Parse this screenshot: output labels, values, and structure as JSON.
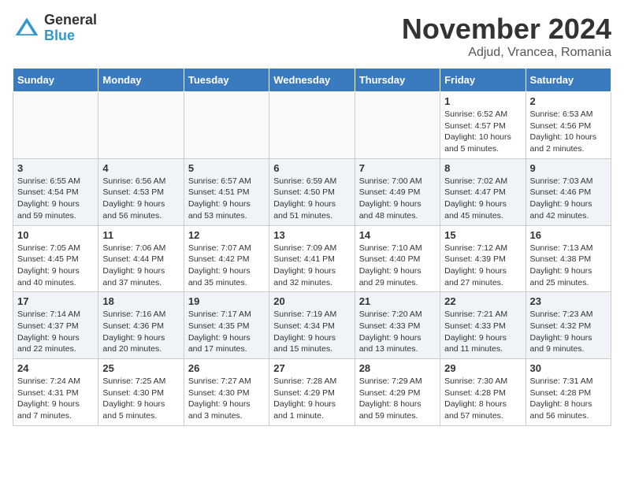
{
  "logo": {
    "general": "General",
    "blue": "Blue"
  },
  "header": {
    "month": "November 2024",
    "location": "Adjud, Vrancea, Romania"
  },
  "days_of_week": [
    "Sunday",
    "Monday",
    "Tuesday",
    "Wednesday",
    "Thursday",
    "Friday",
    "Saturday"
  ],
  "weeks": [
    [
      {
        "day": "",
        "info": ""
      },
      {
        "day": "",
        "info": ""
      },
      {
        "day": "",
        "info": ""
      },
      {
        "day": "",
        "info": ""
      },
      {
        "day": "",
        "info": ""
      },
      {
        "day": "1",
        "info": "Sunrise: 6:52 AM\nSunset: 4:57 PM\nDaylight: 10 hours and 5 minutes."
      },
      {
        "day": "2",
        "info": "Sunrise: 6:53 AM\nSunset: 4:56 PM\nDaylight: 10 hours and 2 minutes."
      }
    ],
    [
      {
        "day": "3",
        "info": "Sunrise: 6:55 AM\nSunset: 4:54 PM\nDaylight: 9 hours and 59 minutes."
      },
      {
        "day": "4",
        "info": "Sunrise: 6:56 AM\nSunset: 4:53 PM\nDaylight: 9 hours and 56 minutes."
      },
      {
        "day": "5",
        "info": "Sunrise: 6:57 AM\nSunset: 4:51 PM\nDaylight: 9 hours and 53 minutes."
      },
      {
        "day": "6",
        "info": "Sunrise: 6:59 AM\nSunset: 4:50 PM\nDaylight: 9 hours and 51 minutes."
      },
      {
        "day": "7",
        "info": "Sunrise: 7:00 AM\nSunset: 4:49 PM\nDaylight: 9 hours and 48 minutes."
      },
      {
        "day": "8",
        "info": "Sunrise: 7:02 AM\nSunset: 4:47 PM\nDaylight: 9 hours and 45 minutes."
      },
      {
        "day": "9",
        "info": "Sunrise: 7:03 AM\nSunset: 4:46 PM\nDaylight: 9 hours and 42 minutes."
      }
    ],
    [
      {
        "day": "10",
        "info": "Sunrise: 7:05 AM\nSunset: 4:45 PM\nDaylight: 9 hours and 40 minutes."
      },
      {
        "day": "11",
        "info": "Sunrise: 7:06 AM\nSunset: 4:44 PM\nDaylight: 9 hours and 37 minutes."
      },
      {
        "day": "12",
        "info": "Sunrise: 7:07 AM\nSunset: 4:42 PM\nDaylight: 9 hours and 35 minutes."
      },
      {
        "day": "13",
        "info": "Sunrise: 7:09 AM\nSunset: 4:41 PM\nDaylight: 9 hours and 32 minutes."
      },
      {
        "day": "14",
        "info": "Sunrise: 7:10 AM\nSunset: 4:40 PM\nDaylight: 9 hours and 29 minutes."
      },
      {
        "day": "15",
        "info": "Sunrise: 7:12 AM\nSunset: 4:39 PM\nDaylight: 9 hours and 27 minutes."
      },
      {
        "day": "16",
        "info": "Sunrise: 7:13 AM\nSunset: 4:38 PM\nDaylight: 9 hours and 25 minutes."
      }
    ],
    [
      {
        "day": "17",
        "info": "Sunrise: 7:14 AM\nSunset: 4:37 PM\nDaylight: 9 hours and 22 minutes."
      },
      {
        "day": "18",
        "info": "Sunrise: 7:16 AM\nSunset: 4:36 PM\nDaylight: 9 hours and 20 minutes."
      },
      {
        "day": "19",
        "info": "Sunrise: 7:17 AM\nSunset: 4:35 PM\nDaylight: 9 hours and 17 minutes."
      },
      {
        "day": "20",
        "info": "Sunrise: 7:19 AM\nSunset: 4:34 PM\nDaylight: 9 hours and 15 minutes."
      },
      {
        "day": "21",
        "info": "Sunrise: 7:20 AM\nSunset: 4:33 PM\nDaylight: 9 hours and 13 minutes."
      },
      {
        "day": "22",
        "info": "Sunrise: 7:21 AM\nSunset: 4:33 PM\nDaylight: 9 hours and 11 minutes."
      },
      {
        "day": "23",
        "info": "Sunrise: 7:23 AM\nSunset: 4:32 PM\nDaylight: 9 hours and 9 minutes."
      }
    ],
    [
      {
        "day": "24",
        "info": "Sunrise: 7:24 AM\nSunset: 4:31 PM\nDaylight: 9 hours and 7 minutes."
      },
      {
        "day": "25",
        "info": "Sunrise: 7:25 AM\nSunset: 4:30 PM\nDaylight: 9 hours and 5 minutes."
      },
      {
        "day": "26",
        "info": "Sunrise: 7:27 AM\nSunset: 4:30 PM\nDaylight: 9 hours and 3 minutes."
      },
      {
        "day": "27",
        "info": "Sunrise: 7:28 AM\nSunset: 4:29 PM\nDaylight: 9 hours and 1 minute."
      },
      {
        "day": "28",
        "info": "Sunrise: 7:29 AM\nSunset: 4:29 PM\nDaylight: 8 hours and 59 minutes."
      },
      {
        "day": "29",
        "info": "Sunrise: 7:30 AM\nSunset: 4:28 PM\nDaylight: 8 hours and 57 minutes."
      },
      {
        "day": "30",
        "info": "Sunrise: 7:31 AM\nSunset: 4:28 PM\nDaylight: 8 hours and 56 minutes."
      }
    ]
  ]
}
